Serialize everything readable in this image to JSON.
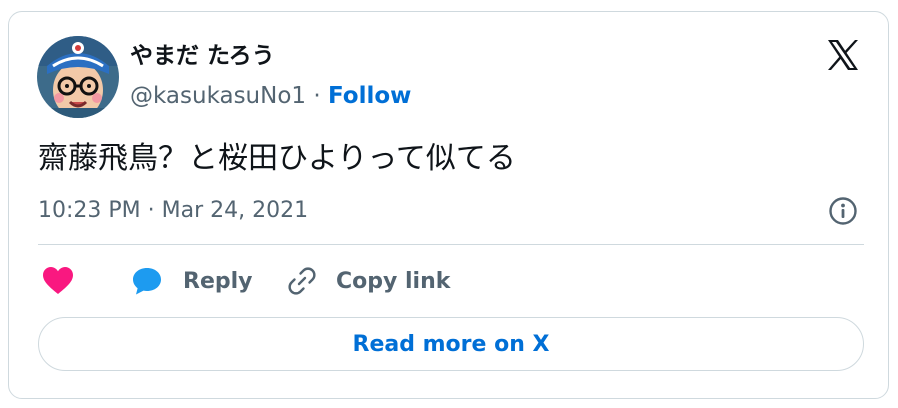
{
  "author": {
    "display_name": "やまだ たろう",
    "handle": "@kasukasuNo1",
    "separator": "·",
    "follow_label": "Follow"
  },
  "tweet": {
    "text": "齋藤飛鳥？と桜田ひよりって似てる",
    "timestamp": "10:23 PM · Mar 24, 2021"
  },
  "actions": {
    "like_icon": "heart-icon",
    "reply_label": "Reply",
    "copy_label": "Copy link"
  },
  "footer": {
    "read_more_label": "Read more on X"
  },
  "icons": {
    "brand": "x-logo-icon",
    "info": "info-icon",
    "reply": "speech-bubble-icon",
    "copy": "link-icon"
  },
  "colors": {
    "accent": "#006fd6",
    "like": "#f91880",
    "reply_icon": "#1d9bf0",
    "muted": "#536471",
    "border": "#cfd9de"
  }
}
